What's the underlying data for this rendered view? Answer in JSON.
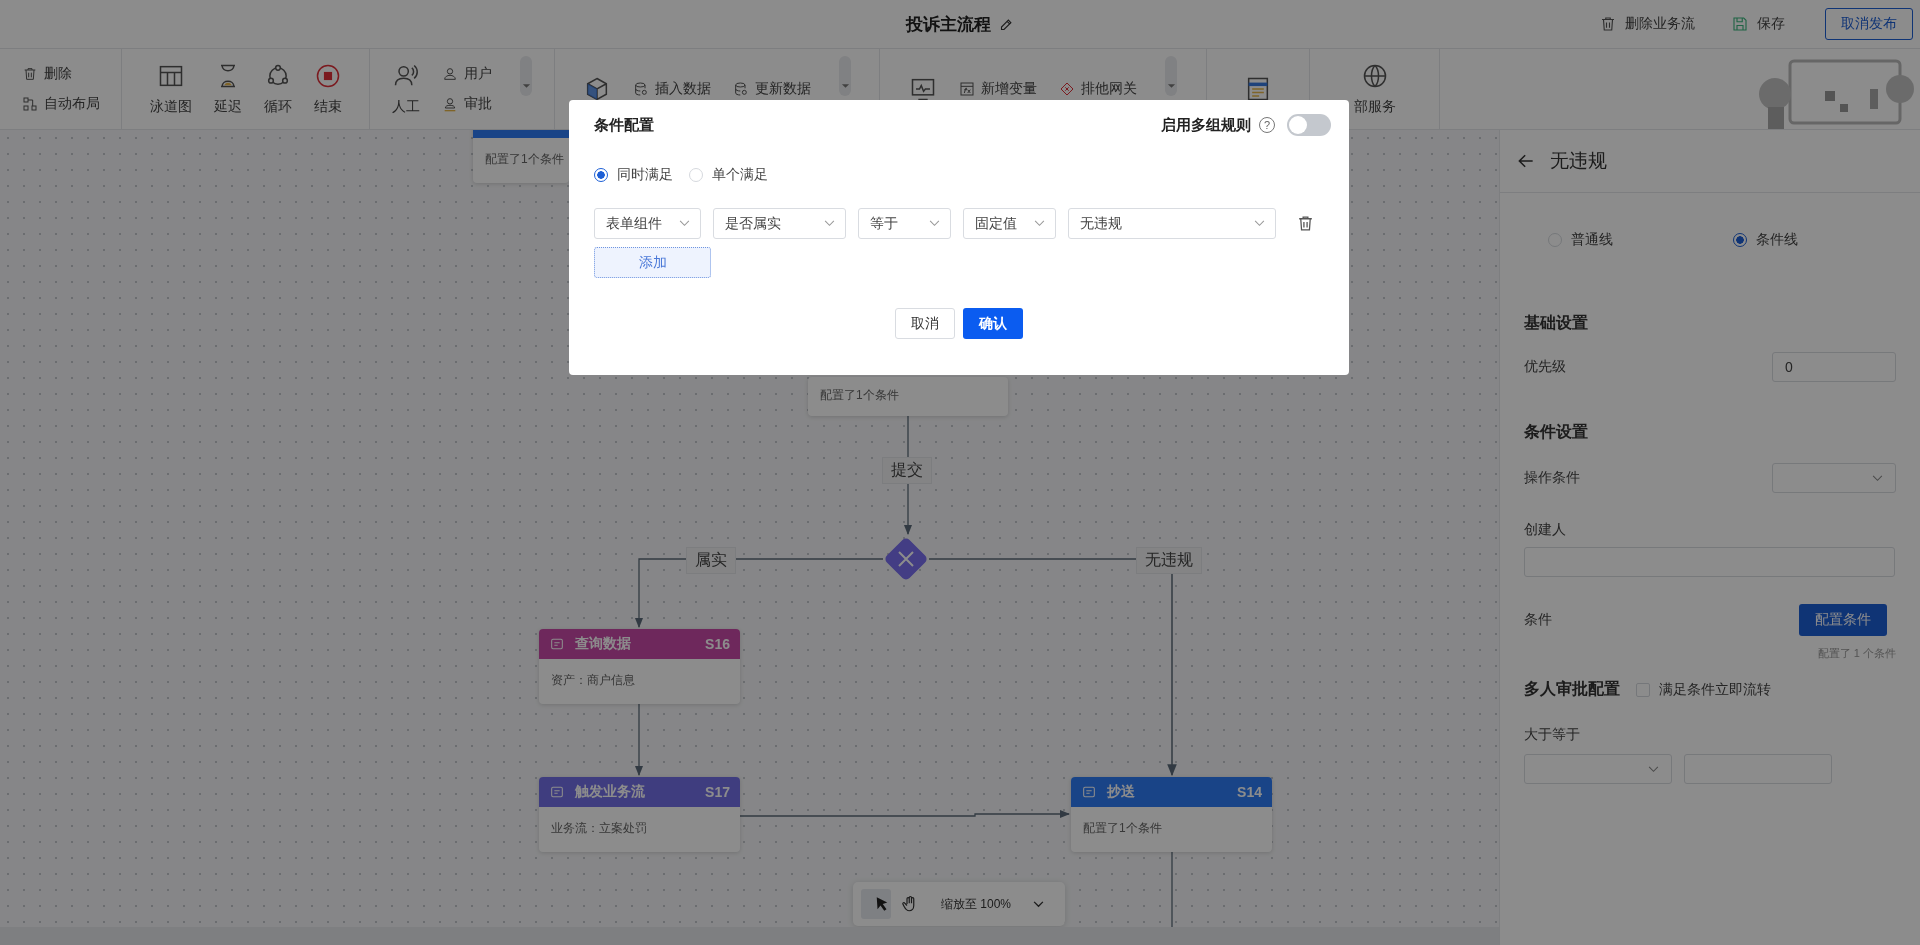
{
  "header": {
    "title": "投诉主流程",
    "actions": [
      {
        "label": "删除业务流"
      },
      {
        "label": "保存"
      }
    ],
    "publish_button": "取消发布"
  },
  "toolbar": [
    {
      "columns": [
        {
          "kind": "stack",
          "items": [
            "删除",
            "自动布局"
          ]
        }
      ]
    },
    {
      "columns": [
        {
          "kind": "large",
          "label": "泳道图"
        },
        {
          "kind": "large",
          "label": "延迟"
        },
        {
          "kind": "large",
          "label": "循环"
        },
        {
          "kind": "large",
          "label": "结束"
        }
      ]
    },
    {
      "scrollable": true,
      "columns": [
        {
          "kind": "large",
          "label": "人工"
        },
        {
          "kind": "stack",
          "items": [
            "用户",
            "审批"
          ]
        }
      ]
    },
    {
      "scrollable": true,
      "columns": [
        {
          "kind": "large"
        },
        {
          "kind": "stack",
          "items": [
            "插入数据"
          ]
        },
        {
          "kind": "stack",
          "items": [
            "更新数据"
          ]
        }
      ]
    },
    {
      "scrollable": true,
      "columns": [
        {
          "kind": "large"
        },
        {
          "kind": "stack",
          "items": [
            "新增变量"
          ]
        },
        {
          "kind": "stack",
          "items": [
            "排他网关"
          ]
        }
      ]
    },
    {
      "columns": [
        {
          "kind": "large"
        }
      ]
    },
    {
      "columns": [
        {
          "kind": "large",
          "label": "部服务"
        }
      ]
    }
  ],
  "canvas": {
    "nodes": [
      {
        "kind": "cc",
        "body": "配置了1个条件"
      },
      {
        "body": "配置了1个条件"
      },
      {
        "kind": "query",
        "title": "查询数据",
        "code": "S16",
        "body": "资产：商户信息"
      },
      {
        "kind": "trigger",
        "title": "触发业务流",
        "code": "S17",
        "body": "业务流：立案处罚"
      },
      {
        "kind": "cc",
        "title": "抄送",
        "code": "S14",
        "body": "配置了1个条件"
      }
    ],
    "edge_labels": [
      "提交",
      "属实",
      "无违规"
    ],
    "zoom_control": {
      "tools": [
        {
          "selected": true
        },
        {
          "selected": false
        }
      ],
      "label": "缩放至 100%"
    }
  },
  "panel": {
    "title": "无违规",
    "line_types": [
      {
        "label": "普通线",
        "selected": false
      },
      {
        "label": "条件线",
        "selected": true
      }
    ],
    "basic": {
      "heading": "基础设置",
      "priority": {
        "label": "优先级",
        "value": "0"
      }
    },
    "conditions": {
      "heading": "条件设置",
      "operation": {
        "label": "操作条件"
      },
      "creator": {
        "label": "创建人"
      },
      "condition": {
        "label": "条件",
        "button": "配置条件",
        "note": "配置了 1 个条件"
      }
    },
    "multi_approval": {
      "heading": "多人审批配置",
      "checkbox": {
        "label": "满足条件立即流转",
        "checked": false
      },
      "threshold": {
        "label": "大于等于"
      }
    }
  },
  "dialog": {
    "title": "条件配置",
    "multi_rules": {
      "label": "启用多组规则",
      "help": "?",
      "on": false
    },
    "match_modes": [
      {
        "label": "同时满足",
        "selected": true
      },
      {
        "label": "单个满足",
        "selected": false
      }
    ],
    "rule_fields": [
      "表单组件",
      "是否属实",
      "等于",
      "固定值",
      "无违规"
    ],
    "add_button": "添加",
    "cancel_button": "取消",
    "confirm_button": "确认"
  }
}
